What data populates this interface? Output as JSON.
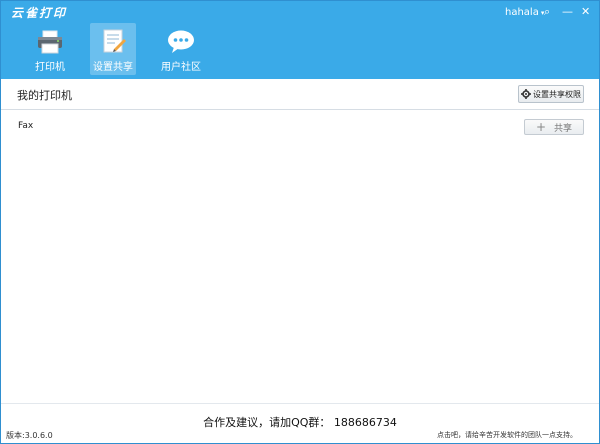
{
  "app": {
    "title": "云雀打印"
  },
  "user": {
    "name": "hahala",
    "caret": "▾"
  },
  "window_controls": {
    "search": "⌕",
    "minimize": "—",
    "close": "✕"
  },
  "nav": [
    {
      "label": "打印机",
      "icon": "printer-icon",
      "active": false
    },
    {
      "label": "设置共享",
      "icon": "share-settings-icon",
      "active": true
    },
    {
      "label": "用户社区",
      "icon": "chat-bubble-icon",
      "active": false
    }
  ],
  "toolbar": {
    "title": "我的打印机",
    "permissions_button": "设置共享权限"
  },
  "printers": [
    {
      "name": "Fax",
      "share_label": "共享",
      "share_plus": "+"
    }
  ],
  "footer": {
    "contact": "合作及建议，请加QQ群： 188686734",
    "version": "版本:3.0.6.0",
    "tip": "点击吧，请给辛苦开发软件的团队一点支持。"
  },
  "colors": {
    "titlebar": "#3aaae8",
    "text": "#222222"
  }
}
